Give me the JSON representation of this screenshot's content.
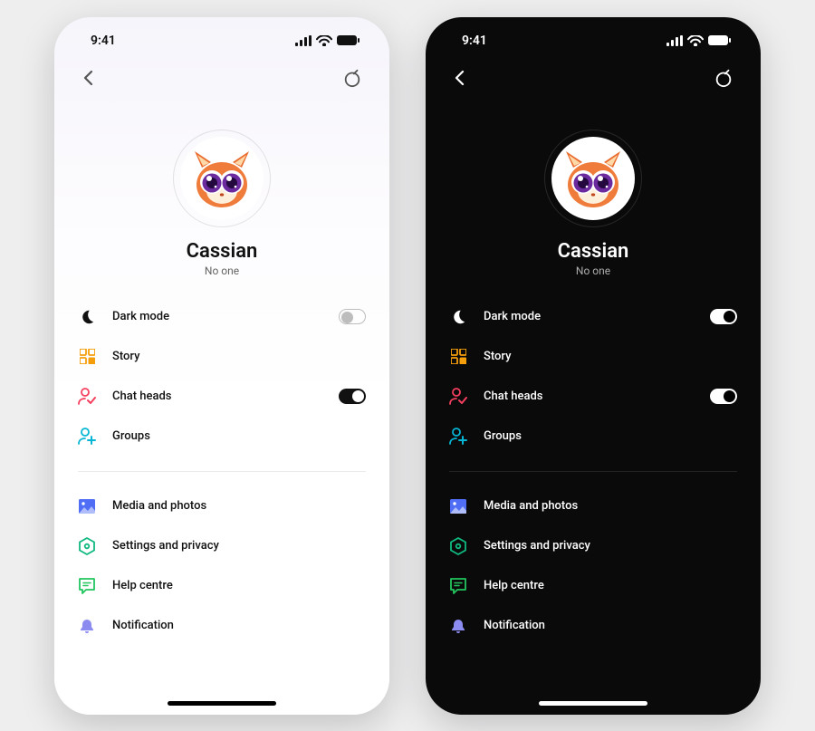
{
  "status": {
    "time": "9:41"
  },
  "profile": {
    "name": "Cassian",
    "subtitle": "No one"
  },
  "settings": {
    "dark_mode": {
      "label": "Dark mode",
      "on_light": false,
      "on_dark": true
    },
    "story": {
      "label": "Story"
    },
    "chat_heads": {
      "label": "Chat heads",
      "on_light": true,
      "on_dark": true
    },
    "groups": {
      "label": "Groups"
    },
    "media": {
      "label": "Media and photos"
    },
    "privacy": {
      "label": "Settings and privacy"
    },
    "help": {
      "label": "Help centre"
    },
    "notification": {
      "label": "Notification"
    }
  },
  "colors": {
    "moon": "#111111",
    "story": "#f59e0b",
    "chat_heads": "#f43f5e",
    "groups": "#06b6d4",
    "media": "#4f6df5",
    "privacy": "#10b981",
    "help": "#22c55e",
    "notification": "#8b8bf0"
  }
}
